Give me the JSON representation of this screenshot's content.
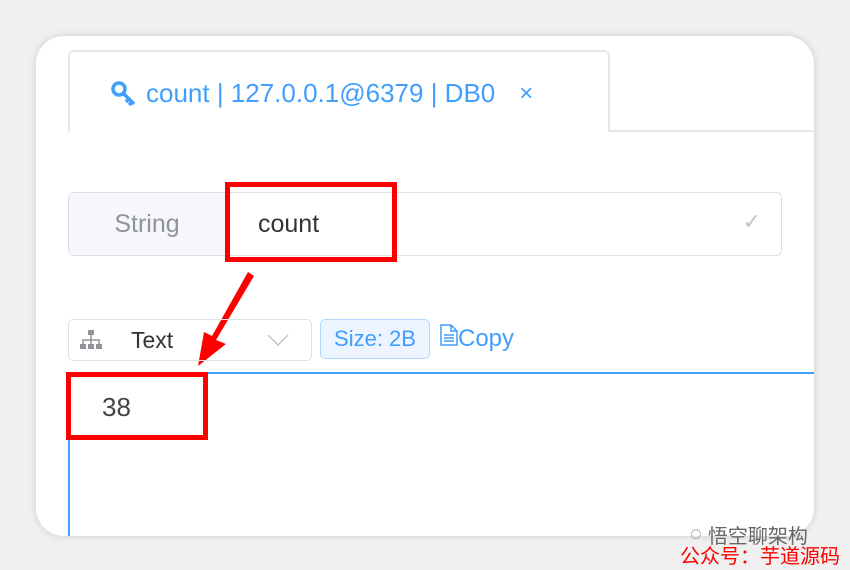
{
  "tab": {
    "icon": "key-icon",
    "title": "count | 127.0.0.1@6379 | DB0",
    "close": "×"
  },
  "key": {
    "type": "String",
    "name": "count",
    "confirm": "✓"
  },
  "toolbar": {
    "format_icon": "sitemap-icon",
    "format": "Text",
    "size": "Size: 2B",
    "copy": "Copy"
  },
  "value": "38",
  "watermark": {
    "line1": "悟空聊架构",
    "line2": "公众号：芋道源码"
  },
  "colors": {
    "accent": "#409eff",
    "annotation": "#ff0000"
  }
}
